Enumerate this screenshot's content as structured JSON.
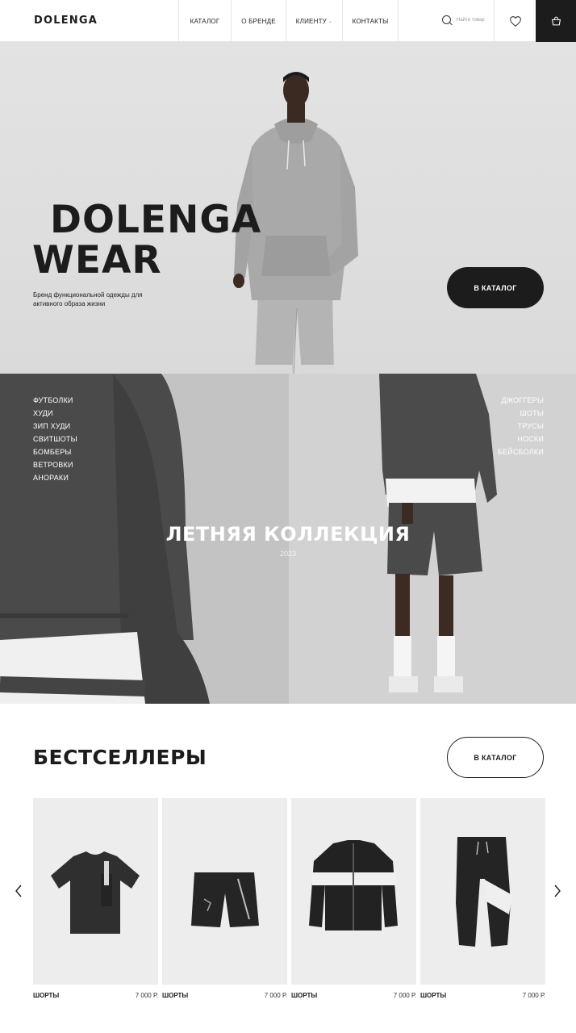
{
  "header": {
    "logo": "DOLENGA",
    "nav": [
      {
        "label": "КАТАЛОГ",
        "dropdown": false
      },
      {
        "label": "О БРЕНДЕ",
        "dropdown": false
      },
      {
        "label": "КЛИЕНТУ",
        "dropdown": true
      },
      {
        "label": "КОНТАКТЫ",
        "dropdown": false
      }
    ],
    "search_placeholder": "Найти товар",
    "icons": {
      "search": "search-icon",
      "favorites": "heart-icon",
      "cart": "basket-icon"
    }
  },
  "hero": {
    "title_line1": "DOLENGA",
    "title_line2": "WEAR",
    "subtitle": "Бренд функциональной одежды для активного образа жизни",
    "button": "В КАТАЛОГ"
  },
  "collection": {
    "title": "ЛЕТНЯЯ КОЛЛЕКЦИЯ",
    "year": "2023",
    "left_categories": [
      "ФУТБОЛКИ",
      "ХУДИ",
      "ЗИП ХУДИ",
      "СВИТШОТЫ",
      "БОМБЕРЫ",
      "ВЕТРОВКИ",
      "АНОРАКИ"
    ],
    "right_categories": [
      "ДЖОГГЕРЫ",
      "ШОТЫ",
      "ТРУСЫ",
      "НОСКИ",
      "БЕЙСБОЛКИ"
    ]
  },
  "bestsellers": {
    "title": "БЕСТСЕЛЛЕРЫ",
    "button": "В КАТАЛОГ",
    "products": [
      {
        "name": "ШОРТЫ",
        "price": "7 000 Р.",
        "image": "tshirt"
      },
      {
        "name": "ШОРТЫ",
        "price": "7 000 Р.",
        "image": "shorts"
      },
      {
        "name": "ШОРТЫ",
        "price": "7 000 Р.",
        "image": "jacket"
      },
      {
        "name": "ШОРТЫ",
        "price": "7 000 Р.",
        "image": "joggers"
      }
    ]
  },
  "colors": {
    "primary": "#1c1c1c",
    "background": "#ffffff",
    "hero_bg": "#e0e0e0"
  }
}
